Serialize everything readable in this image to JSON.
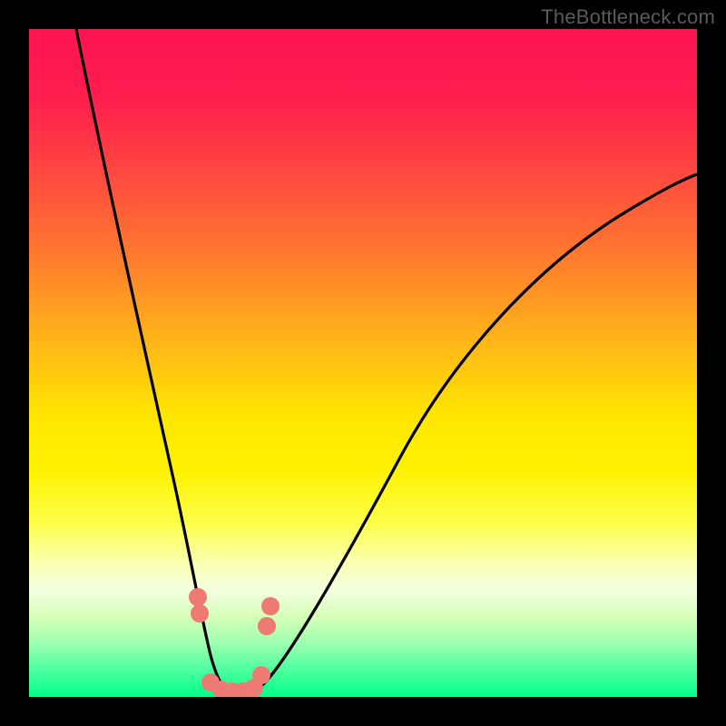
{
  "watermark": "TheBottleneck.com",
  "chart_data": {
    "type": "line",
    "title": "",
    "xlabel": "",
    "ylabel": "",
    "xlim": [
      0,
      100
    ],
    "ylim": [
      0,
      100
    ],
    "series": [
      {
        "name": "bottleneck-curve",
        "x": [
          7,
          10,
          14,
          18,
          22,
          24,
          26,
          27,
          28,
          30,
          32,
          34,
          36,
          40,
          46,
          54,
          64,
          76,
          90,
          100
        ],
        "values": [
          100,
          86,
          68,
          50,
          30,
          18,
          8,
          2,
          0,
          0,
          1,
          4,
          8,
          16,
          26,
          38,
          50,
          60,
          68,
          72
        ]
      },
      {
        "name": "highlight-dots",
        "x": [
          24.0,
          24.3,
          26.0,
          27.5,
          29.0,
          30.5,
          32.0,
          33.0,
          33.8,
          34.2
        ],
        "values": [
          14.0,
          11.0,
          1.5,
          0.8,
          0.6,
          0.6,
          1.0,
          3.0,
          10.0,
          13.0
        ]
      }
    ],
    "colors": {
      "curve": "#000000",
      "dots": "#ed7b74"
    }
  }
}
